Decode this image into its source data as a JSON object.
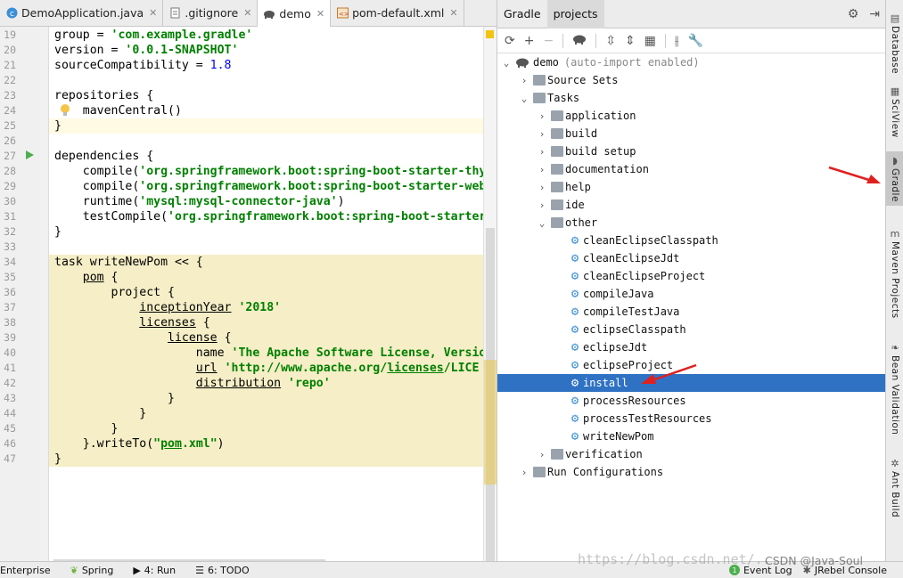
{
  "editor_tabs": [
    {
      "label": "DemoApplication.java",
      "icon": "java-class-icon",
      "active": false
    },
    {
      "label": ".gitignore",
      "icon": "file-icon",
      "active": false
    },
    {
      "label": "demo",
      "icon": "gradle-elephant-icon",
      "active": true
    },
    {
      "label": "pom-default.xml",
      "icon": "xml-file-icon",
      "active": false
    }
  ],
  "code_lines": [
    {
      "num": "19",
      "text": "group = 'com.example.gradle'"
    },
    {
      "num": "20",
      "text": "version = '0.0.1-SNAPSHOT'"
    },
    {
      "num": "21",
      "text": "sourceCompatibility = 1.8"
    },
    {
      "num": "22",
      "text": ""
    },
    {
      "num": "23",
      "text": "repositories {"
    },
    {
      "num": "24",
      "text": "    mavenCentral()"
    },
    {
      "num": "25",
      "text": "}"
    },
    {
      "num": "26",
      "text": ""
    },
    {
      "num": "27",
      "text": "dependencies {"
    },
    {
      "num": "28",
      "text": "    compile('org.springframework.boot:spring-boot-starter-thym"
    },
    {
      "num": "29",
      "text": "    compile('org.springframework.boot:spring-boot-starter-web'"
    },
    {
      "num": "30",
      "text": "    runtime('mysql:mysql-connector-java')"
    },
    {
      "num": "31",
      "text": "    testCompile('org.springframework.boot:spring-boot-starter-"
    },
    {
      "num": "32",
      "text": "}"
    },
    {
      "num": "33",
      "text": ""
    },
    {
      "num": "34",
      "text": "task writeNewPom << {"
    },
    {
      "num": "35",
      "text": "    pom {"
    },
    {
      "num": "36",
      "text": "        project {"
    },
    {
      "num": "37",
      "text": "            inceptionYear '2018'"
    },
    {
      "num": "38",
      "text": "            licenses {"
    },
    {
      "num": "39",
      "text": "                license {"
    },
    {
      "num": "40",
      "text": "                    name 'The Apache Software License, Version"
    },
    {
      "num": "41",
      "text": "                    url 'http://www.apache.org/licenses/LICE"
    },
    {
      "num": "42",
      "text": "                    distribution 'repo'"
    },
    {
      "num": "43",
      "text": "                }"
    },
    {
      "num": "44",
      "text": "            }"
    },
    {
      "num": "45",
      "text": "        }"
    },
    {
      "num": "46",
      "text": "    }.writeTo(\"pom.xml\")"
    },
    {
      "num": "47",
      "text": "}"
    }
  ],
  "gradle_panel": {
    "tabs": [
      "Gradle",
      "projects"
    ],
    "root": {
      "label": "demo",
      "note": "(auto-import enabled)"
    },
    "items": [
      {
        "label": "Source Sets",
        "kind": "folder"
      },
      {
        "label": "Tasks",
        "kind": "folder"
      },
      {
        "label": "application",
        "kind": "folder"
      },
      {
        "label": "build",
        "kind": "folder"
      },
      {
        "label": "build setup",
        "kind": "folder"
      },
      {
        "label": "documentation",
        "kind": "folder"
      },
      {
        "label": "help",
        "kind": "folder"
      },
      {
        "label": "ide",
        "kind": "folder"
      },
      {
        "label": "other",
        "kind": "folder"
      },
      {
        "label": "cleanEclipseClasspath",
        "kind": "task"
      },
      {
        "label": "cleanEclipseJdt",
        "kind": "task"
      },
      {
        "label": "cleanEclipseProject",
        "kind": "task"
      },
      {
        "label": "compileJava",
        "kind": "task"
      },
      {
        "label": "compileTestJava",
        "kind": "task"
      },
      {
        "label": "eclipseClasspath",
        "kind": "task"
      },
      {
        "label": "eclipseJdt",
        "kind": "task"
      },
      {
        "label": "eclipseProject",
        "kind": "task"
      },
      {
        "label": "install",
        "kind": "task",
        "selected": true
      },
      {
        "label": "processResources",
        "kind": "task"
      },
      {
        "label": "processTestResources",
        "kind": "task"
      },
      {
        "label": "writeNewPom",
        "kind": "task"
      },
      {
        "label": "verification",
        "kind": "folder"
      },
      {
        "label": "Run Configurations",
        "kind": "folder"
      }
    ]
  },
  "right_sidebar": [
    {
      "label": "Database",
      "icon": "database-icon"
    },
    {
      "label": "SciView",
      "icon": "sciview-icon"
    },
    {
      "label": "Gradle",
      "icon": "gradle-elephant-icon",
      "active": true
    },
    {
      "label": "Maven Projects",
      "icon": "maven-icon"
    },
    {
      "label": "Bean Validation",
      "icon": "bean-icon"
    },
    {
      "label": "Ant Build",
      "icon": "ant-icon"
    }
  ],
  "status_bar": {
    "enterprise": "Enterprise",
    "spring": "Spring",
    "run": "4: Run",
    "todo": "6: TODO",
    "event_log_count": "1",
    "event_log": "Event Log",
    "jrebel": "JRebel Console"
  },
  "watermark": "https://blog.csdn.net/...",
  "watermark_brand": "CSDN @Java-Soul",
  "accent_color": "#2f72c4",
  "highlight_color": "#f5eec6"
}
